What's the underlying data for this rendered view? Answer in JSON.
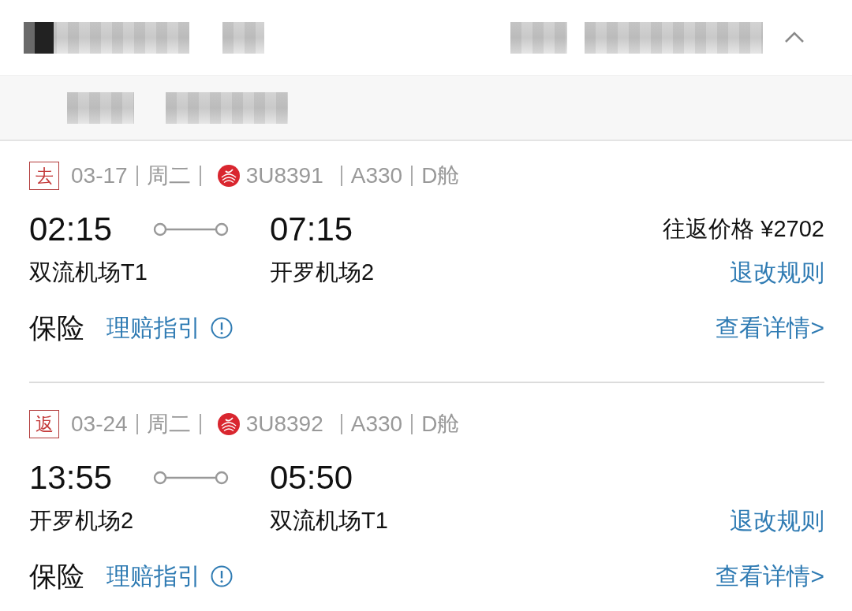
{
  "header": {
    "expanded": true
  },
  "segments": [
    {
      "direction": "去",
      "date": "03-17",
      "weekday": "周二",
      "flight_no": "3U8391",
      "aircraft": "A330",
      "cabin": "D舱",
      "depart_time": "02:15",
      "arrive_time": "07:15",
      "price_label": "往返价格",
      "price": "¥2702",
      "depart_airport": "双流机场T1",
      "arrive_airport": "开罗机场2",
      "rules_link": "退改规则",
      "insurance_label": "保险",
      "claims_link": "理赔指引",
      "details_link": "查看详情>"
    },
    {
      "direction": "返",
      "date": "03-24",
      "weekday": "周二",
      "flight_no": "3U8392",
      "aircraft": "A330",
      "cabin": "D舱",
      "depart_time": "13:55",
      "arrive_time": "05:50",
      "depart_airport": "开罗机场2",
      "arrive_airport": "双流机场T1",
      "rules_link": "退改规则",
      "insurance_label": "保险",
      "claims_link": "理赔指引",
      "details_link": "查看详情>"
    }
  ]
}
